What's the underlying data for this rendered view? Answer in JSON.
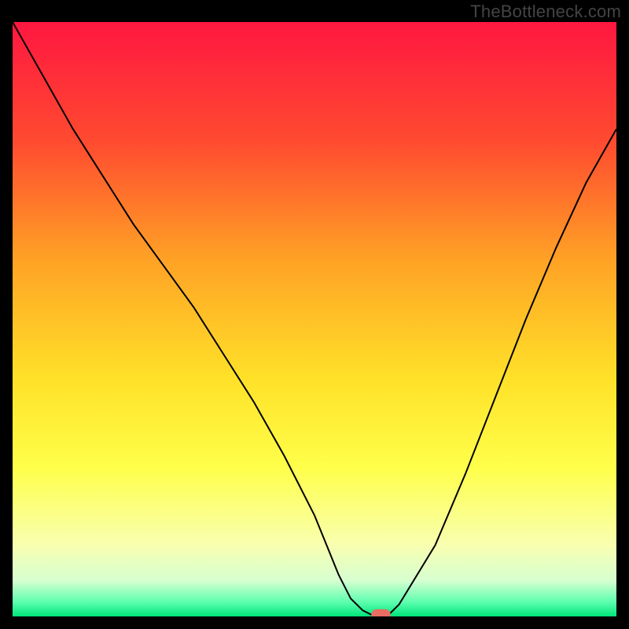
{
  "watermark": "TheBottleneck.com",
  "chart_data": {
    "type": "line",
    "title": "",
    "xlabel": "",
    "ylabel": "",
    "xlim": [
      0,
      100
    ],
    "ylim": [
      0,
      100
    ],
    "series": [
      {
        "name": "bottleneck-curve",
        "x": [
          0,
          5,
          10,
          15,
          20,
          25,
          30,
          35,
          40,
          45,
          50,
          52,
          54,
          56,
          58,
          60,
          62,
          64,
          70,
          75,
          80,
          85,
          90,
          95,
          100
        ],
        "y": [
          100,
          91,
          82,
          74,
          66,
          59,
          52,
          44,
          36,
          27,
          17,
          12,
          7,
          3,
          1,
          0,
          0,
          2,
          12,
          24,
          37,
          50,
          62,
          73,
          82
        ]
      }
    ],
    "minimum_marker": {
      "x": 61,
      "y": 0
    },
    "background": {
      "gradient_stops": [
        {
          "offset": 0.0,
          "color": "#ff1740"
        },
        {
          "offset": 0.2,
          "color": "#ff4a30"
        },
        {
          "offset": 0.4,
          "color": "#ffa225"
        },
        {
          "offset": 0.6,
          "color": "#ffe128"
        },
        {
          "offset": 0.75,
          "color": "#ffff4a"
        },
        {
          "offset": 0.88,
          "color": "#f8ffb0"
        },
        {
          "offset": 0.94,
          "color": "#d6ffd0"
        },
        {
          "offset": 0.975,
          "color": "#60ffb0"
        },
        {
          "offset": 1.0,
          "color": "#00e57a"
        }
      ]
    },
    "marker_color": "#e86d62",
    "curve_color": "#000000"
  }
}
